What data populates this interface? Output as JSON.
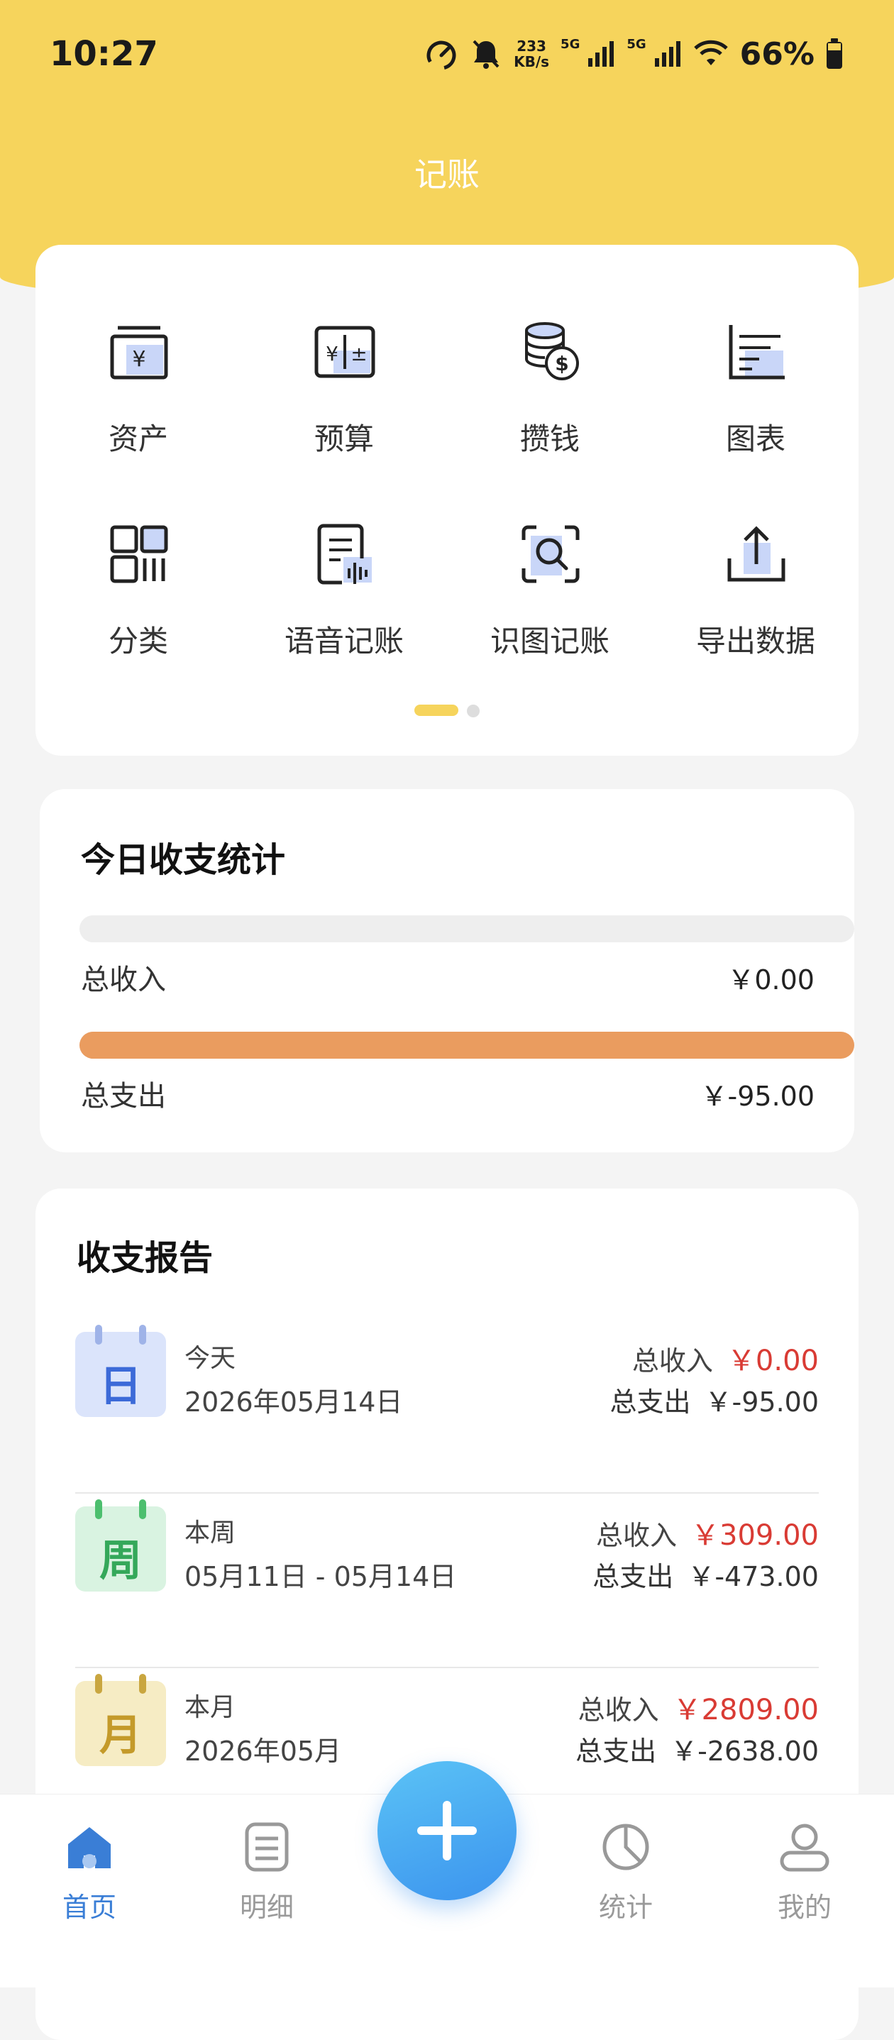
{
  "status_bar": {
    "time": "10:27",
    "net_speed_value": "233",
    "net_speed_unit": "KB/s",
    "sim1": "5G",
    "sim2": "5G",
    "battery": "66%"
  },
  "header": {
    "title": "记账"
  },
  "quick_grid": {
    "items": [
      {
        "label": "资产",
        "icon": "asset-box-icon"
      },
      {
        "label": "预算",
        "icon": "budget-calculator-icon"
      },
      {
        "label": "攒钱",
        "icon": "coins-stack-icon"
      },
      {
        "label": "图表",
        "icon": "chart-icon"
      },
      {
        "label": "分类",
        "icon": "category-grid-icon"
      },
      {
        "label": "语音记账",
        "icon": "voice-record-icon"
      },
      {
        "label": "识图记账",
        "icon": "image-scan-icon"
      },
      {
        "label": "导出数据",
        "icon": "export-upload-icon"
      }
    ],
    "page_count": 2,
    "current_page": 1
  },
  "today_stats": {
    "title": "今日收支统计",
    "income_label": "总收入",
    "income_value": "￥0.00",
    "income_fill": 0,
    "expense_label": "总支出",
    "expense_value": "￥-95.00",
    "expense_fill": 1
  },
  "report": {
    "title": "收支报告",
    "rows": [
      {
        "badge": "日",
        "name": "今天",
        "date": "2026年05月14日",
        "income_label": "总收入",
        "income": "￥0.00",
        "expense_label": "总支出",
        "expense": "￥-95.00"
      },
      {
        "badge": "周",
        "name": "本周",
        "date": "05月11日 - 05月14日",
        "income_label": "总收入",
        "income": "￥309.00",
        "expense_label": "总支出",
        "expense": "￥-473.00"
      },
      {
        "badge": "月",
        "name": "本月",
        "date": "2026年05月",
        "income_label": "总收入",
        "income": "￥2809.00",
        "expense_label": "总支出",
        "expense": "￥-2638.00"
      }
    ]
  },
  "tabbar": {
    "tabs": [
      {
        "label": "首页",
        "icon": "home-icon",
        "active": true
      },
      {
        "label": "明细",
        "icon": "list-detail-icon",
        "active": false
      },
      {
        "label": "统计",
        "icon": "pie-chart-icon",
        "active": false
      },
      {
        "label": "我的",
        "icon": "profile-icon",
        "active": false
      }
    ],
    "add_button_icon": "plus-icon"
  },
  "colors": {
    "header_yellow": "#f6d45c",
    "income_red": "#d93b34",
    "expense_bar": "#ea9c5f",
    "active_tab_blue": "#3a7ed6",
    "fab_blue": "#3b93ee"
  }
}
